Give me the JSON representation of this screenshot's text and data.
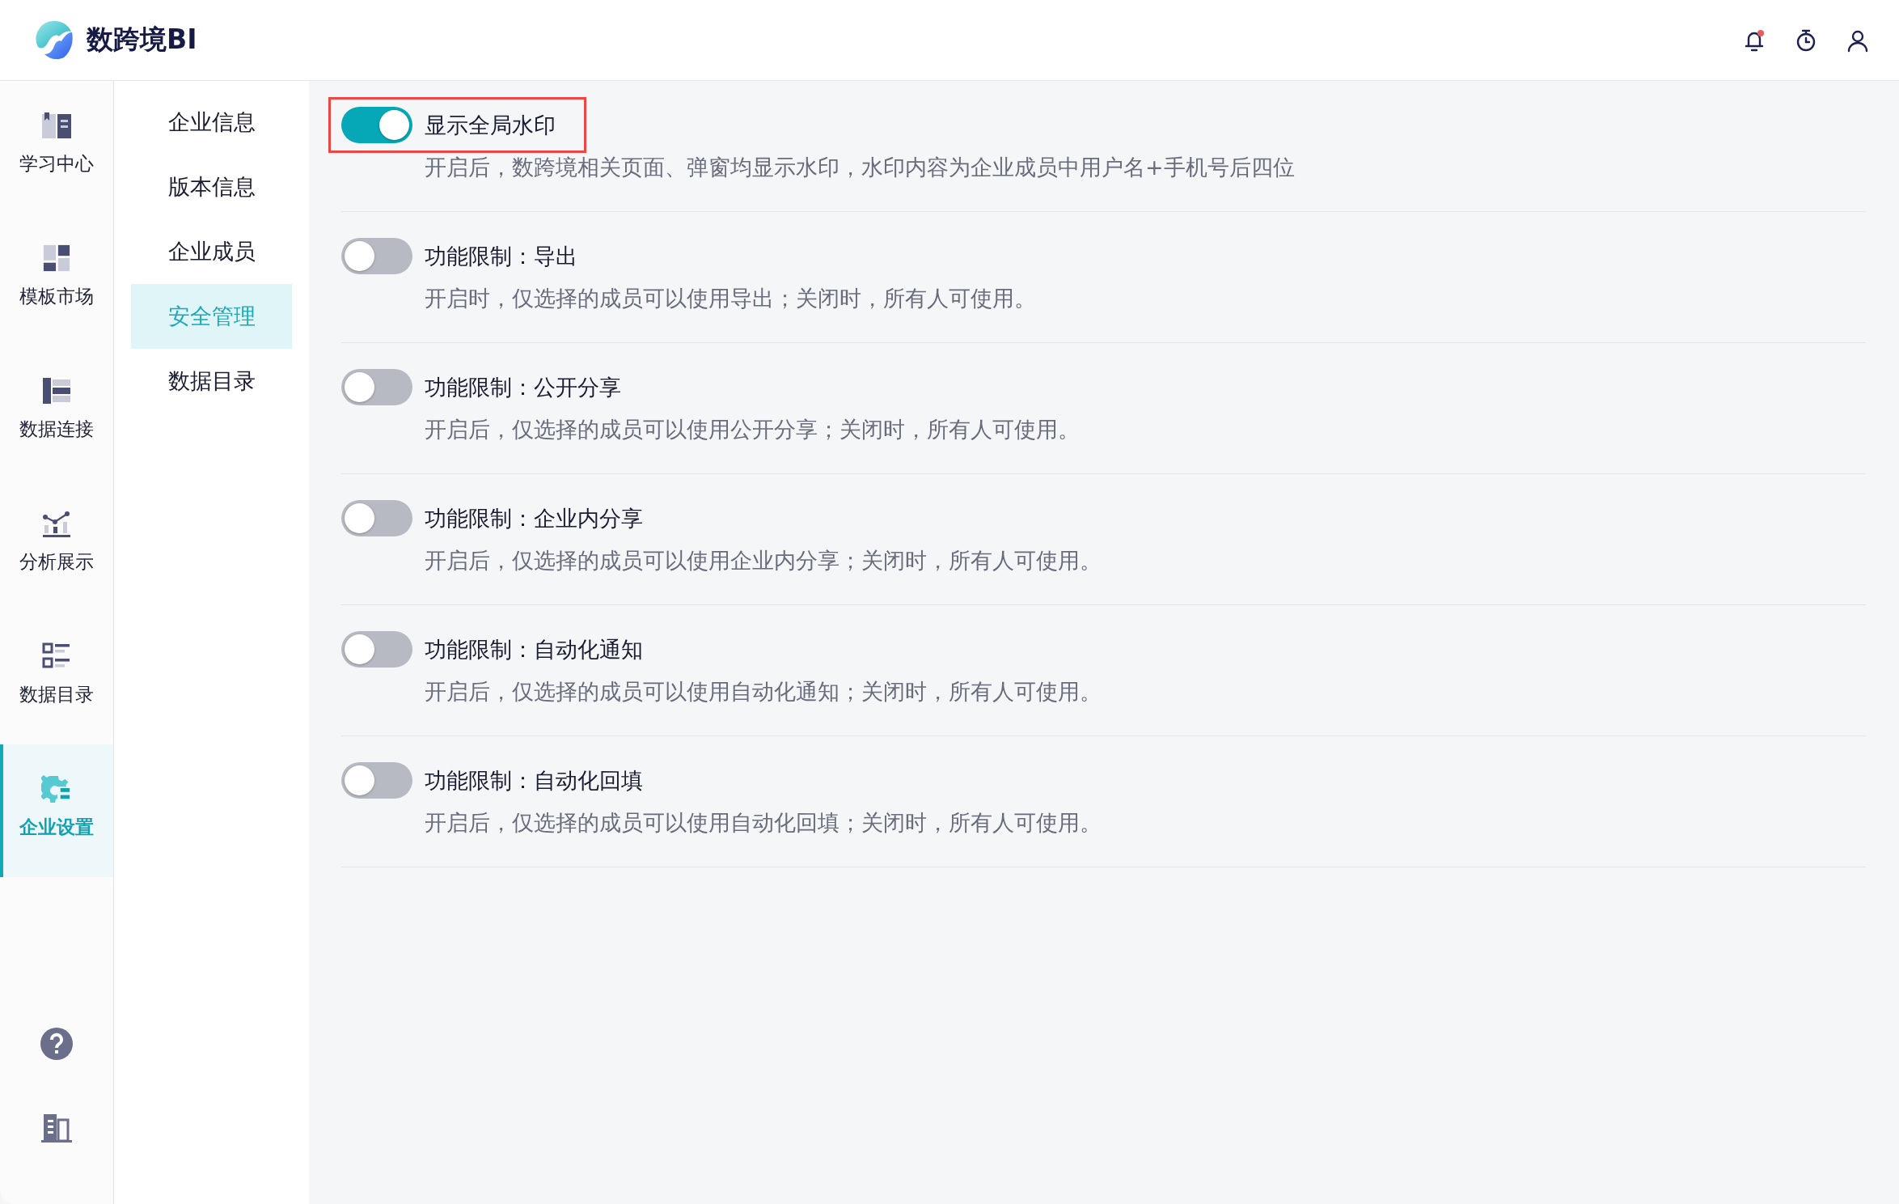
{
  "header": {
    "logo_text": "数跨境BI",
    "notifications_unread": true
  },
  "nav_rail": {
    "items": [
      {
        "label": "学习中心",
        "selected": false
      },
      {
        "label": "模板市场",
        "selected": false
      },
      {
        "label": "数据连接",
        "selected": false
      },
      {
        "label": "分析展示",
        "selected": false
      },
      {
        "label": "数据目录",
        "selected": false
      },
      {
        "label": "企业设置",
        "selected": true
      }
    ]
  },
  "sub_nav": {
    "items": [
      {
        "label": "企业信息",
        "selected": false
      },
      {
        "label": "版本信息",
        "selected": false
      },
      {
        "label": "企业成员",
        "selected": false
      },
      {
        "label": "安全管理",
        "selected": true
      },
      {
        "label": "数据目录",
        "selected": false
      }
    ]
  },
  "settings": [
    {
      "title": "显示全局水印",
      "description": "开启后，数跨境相关页面、弹窗均显示水印，水印内容为企业成员中用户名+手机号后四位",
      "on": true,
      "highlighted": true
    },
    {
      "title": "功能限制：导出",
      "description": "开启时，仅选择的成员可以使用导出；关闭时，所有人可使用。",
      "on": false,
      "highlighted": false
    },
    {
      "title": "功能限制：公开分享",
      "description": "开启后，仅选择的成员可以使用公开分享；关闭时，所有人可使用。",
      "on": false,
      "highlighted": false
    },
    {
      "title": "功能限制：企业内分享",
      "description": "开启后，仅选择的成员可以使用企业内分享；关闭时，所有人可使用。",
      "on": false,
      "highlighted": false
    },
    {
      "title": "功能限制：自动化通知",
      "description": "开启后，仅选择的成员可以使用自动化通知；关闭时，所有人可使用。",
      "on": false,
      "highlighted": false
    },
    {
      "title": "功能限制：自动化回填",
      "description": "开启后，仅选择的成员可以使用自动化回填；关闭时，所有人可使用。",
      "on": false,
      "highlighted": false
    }
  ]
}
